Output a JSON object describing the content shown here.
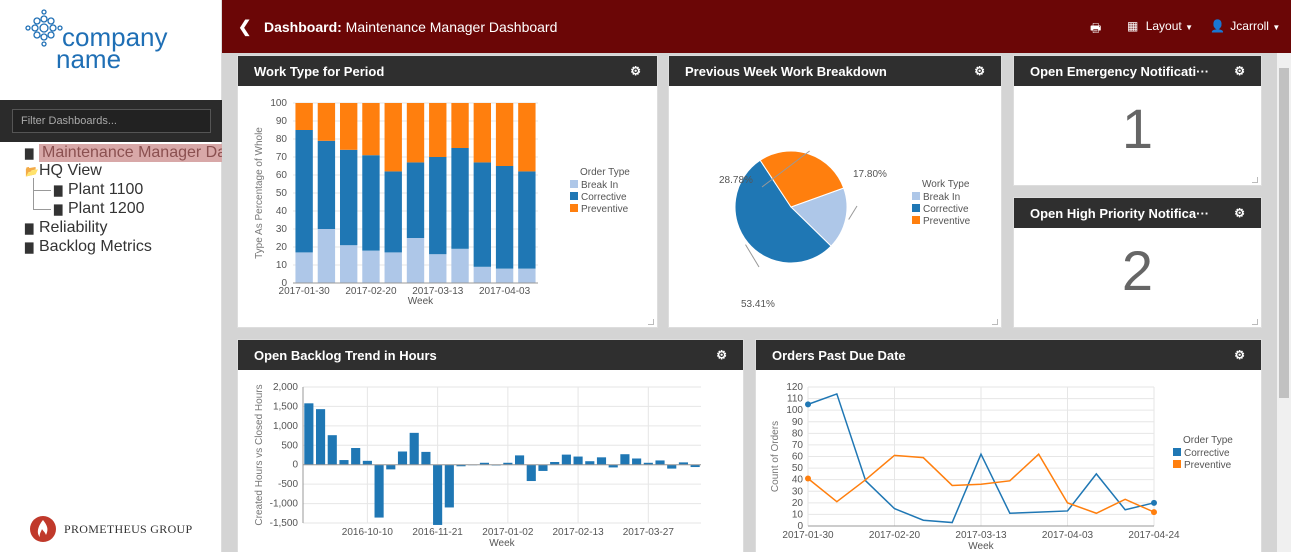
{
  "sidebar": {
    "logo_line1": "company",
    "logo_line2": "name",
    "filter_placeholder": "Filter Dashboards...",
    "items": [
      {
        "label": "Maintenance Manager Dashboard",
        "icon": "bar-chart-icon"
      },
      {
        "label": "HQ View",
        "icon": "folder-open-icon"
      },
      {
        "label": "Plant 1100",
        "icon": "bar-chart-icon"
      },
      {
        "label": "Plant 1200",
        "icon": "bar-chart-icon"
      },
      {
        "label": "Reliability",
        "icon": "bar-chart-icon"
      },
      {
        "label": "Backlog Metrics",
        "icon": "bar-chart-icon"
      }
    ],
    "footer_logo": "PROMETHEUS GROUP"
  },
  "topbar": {
    "title_bold": "Dashboard:",
    "title_rest": " Maintenance Manager Dashboard",
    "layout_label": "Layout",
    "user_label": "Jcarroll",
    "color": "#6b0606"
  },
  "panels": {
    "work_type": "Work Type for Period",
    "prev_week": "Previous Week Work Breakdown",
    "emergency": "Open Emergency Notificati···",
    "high_priority": "Open High Priority Notifica···",
    "backlog": "Open Backlog Trend in Hours",
    "past_due": "Orders Past Due Date"
  },
  "kpis": {
    "emergency_value": "1",
    "high_priority_value": "2"
  },
  "chart_data": [
    {
      "type": "bar",
      "stacked": true,
      "ylabel": "Type As Percentage of Whole",
      "xlabel": "Week",
      "ylim": [
        0,
        100
      ],
      "y_ticks": [
        0,
        10,
        20,
        30,
        40,
        50,
        60,
        70,
        80,
        90,
        100
      ],
      "x_tick_labels": [
        "2017-01-30",
        "2017-02-20",
        "2017-03-13",
        "2017-04-03"
      ],
      "x_tick_index": [
        0,
        3,
        6,
        9
      ],
      "legend_title": "Order Type",
      "legend_position": "right",
      "series": [
        {
          "name": "Break In",
          "color": "#aec7e8",
          "values": [
            17,
            30,
            21,
            18,
            17,
            25,
            16,
            19,
            9,
            8,
            8
          ]
        },
        {
          "name": "Corrective",
          "color": "#1f77b4",
          "values": [
            68,
            49,
            53,
            53,
            45,
            42,
            54,
            56,
            58,
            57,
            54
          ]
        },
        {
          "name": "Preventive",
          "color": "#ff7f0e",
          "values": [
            15,
            21,
            26,
            29,
            38,
            33,
            30,
            25,
            33,
            35,
            38
          ]
        }
      ]
    },
    {
      "type": "pie",
      "legend_title": "Work Type",
      "legend_position": "right",
      "slices": [
        {
          "name": "Break In",
          "value": 17.8,
          "label": "17.80%",
          "color": "#aec7e8"
        },
        {
          "name": "Corrective",
          "value": 53.41,
          "label": "53.41%",
          "color": "#1f77b4"
        },
        {
          "name": "Preventive",
          "value": 28.78,
          "label": "28.78%",
          "color": "#ff7f0e"
        }
      ]
    },
    {
      "type": "bar",
      "ylabel": "Created Hours vs Closed Hours",
      "xlabel": "Week",
      "ylim": [
        -1500,
        2000
      ],
      "y_ticks": [
        -1500,
        -1000,
        -500,
        0,
        500,
        1000,
        1500,
        2000
      ],
      "y_tick_labels": [
        "-1,500",
        "-1,000",
        "-500",
        "0",
        "500",
        "1,000",
        "1,500",
        "2,000"
      ],
      "x_tick_labels": [
        "2016-10-10",
        "2016-11-21",
        "2017-01-02",
        "2017-02-13",
        "2017-03-27"
      ],
      "x_tick_index": [
        5,
        11,
        17,
        23,
        29
      ],
      "series": [
        {
          "name": "",
          "color": "#1f77b4",
          "values": [
            1580,
            1430,
            760,
            120,
            430,
            100,
            -1360,
            -120,
            340,
            820,
            330,
            -1550,
            -1100,
            -40,
            0,
            50,
            -20,
            50,
            240,
            -420,
            -160,
            70,
            260,
            210,
            90,
            190,
            -70,
            270,
            160,
            50,
            110,
            -100,
            60,
            -60
          ]
        }
      ]
    },
    {
      "type": "line",
      "ylabel": "Count of Orders",
      "xlabel": "Week",
      "ylim": [
        0,
        120
      ],
      "y_ticks": [
        0,
        10,
        20,
        30,
        40,
        50,
        60,
        70,
        80,
        90,
        100,
        110,
        120
      ],
      "x_tick_labels": [
        "2017-01-30",
        "2017-02-20",
        "2017-03-13",
        "2017-04-03",
        "2017-04-24"
      ],
      "x_tick_index": [
        0,
        3,
        6,
        9,
        12
      ],
      "legend_title": "Order Type",
      "legend_position": "right",
      "series": [
        {
          "name": "Corrective",
          "color": "#1f77b4",
          "values": [
            105,
            114,
            39,
            15,
            5,
            3,
            62,
            11,
            12,
            13,
            45,
            14,
            20
          ]
        },
        {
          "name": "Preventive",
          "color": "#ff7f0e",
          "values": [
            41,
            21,
            40,
            61,
            59,
            35,
            36,
            39,
            62,
            20,
            11,
            23,
            12
          ]
        }
      ]
    }
  ]
}
